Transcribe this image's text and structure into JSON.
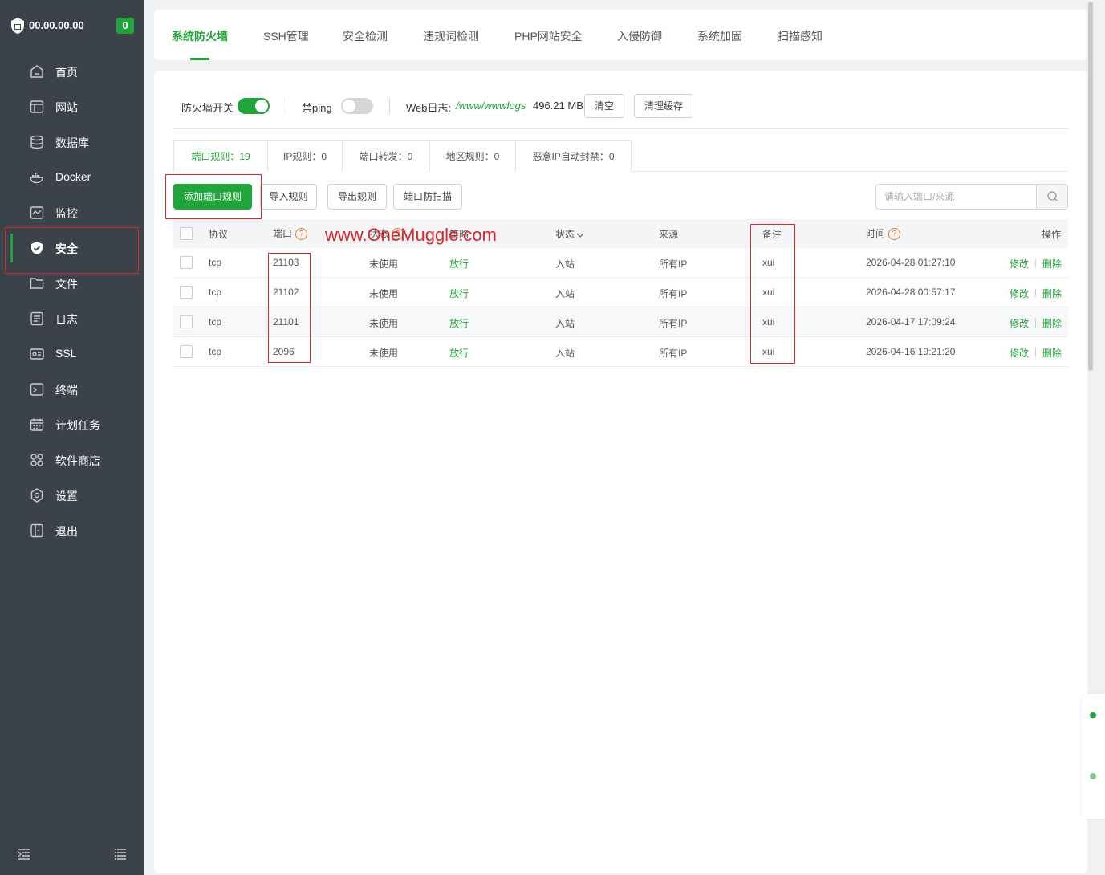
{
  "sidebar": {
    "ip": "00.00.00.00",
    "badge": "0",
    "items": [
      {
        "label": "首页",
        "icon": "home-icon"
      },
      {
        "label": "网站",
        "icon": "website-icon"
      },
      {
        "label": "数据库",
        "icon": "database-icon"
      },
      {
        "label": "Docker",
        "icon": "docker-icon"
      },
      {
        "label": "监控",
        "icon": "monitor-icon"
      },
      {
        "label": "安全",
        "icon": "shield-icon",
        "active": true
      },
      {
        "label": "文件",
        "icon": "folder-icon"
      },
      {
        "label": "日志",
        "icon": "log-icon"
      },
      {
        "label": "SSL",
        "icon": "ssl-icon"
      },
      {
        "label": "终端",
        "icon": "terminal-icon"
      },
      {
        "label": "计划任务",
        "icon": "calendar-icon"
      },
      {
        "label": "软件商店",
        "icon": "app-store-icon"
      },
      {
        "label": "设置",
        "icon": "settings-icon"
      },
      {
        "label": "退出",
        "icon": "logout-icon"
      }
    ]
  },
  "tabs": [
    "系统防火墙",
    "SSH管理",
    "安全检测",
    "违规词检测",
    "PHP网站安全",
    "入侵防御",
    "系统加固",
    "扫描感知"
  ],
  "toolbar": {
    "firewall_label": "防火墙开关",
    "firewall_on": true,
    "ping_label": "禁ping",
    "ping_on": false,
    "weblog_label": "Web日志:",
    "weblog_path": "/www/wwwlogs",
    "weblog_size": "496.21 MB",
    "clear_label": "清空",
    "clear_cache_label": "清理缓存"
  },
  "subtabs": [
    "端口规则：19",
    "IP规则：0",
    "端口转发：0",
    "地区规则：0",
    "恶意IP自动封禁：0"
  ],
  "actions": {
    "add_port_rule": "添加端口规则",
    "import_rules": "导入规则",
    "export_rules": "导出规则",
    "port_anti_scan": "端口防扫描"
  },
  "search": {
    "placeholder": "请输入端口/来源"
  },
  "table": {
    "headers": {
      "protocol": "协议",
      "port": "端口",
      "status": "状态",
      "strategy": "策略",
      "direction": "状态",
      "source": "来源",
      "remark": "备注",
      "time": "时间",
      "ops": "操作"
    },
    "rows": [
      {
        "protocol": "tcp",
        "port": "21103",
        "status": "未使用",
        "strategy": "放行",
        "direction": "入站",
        "source": "所有IP",
        "remark": "xui",
        "time": "2026-04-28 01:27:10",
        "edit": "修改",
        "delete": "删除"
      },
      {
        "protocol": "tcp",
        "port": "21102",
        "status": "未使用",
        "strategy": "放行",
        "direction": "入站",
        "source": "所有IP",
        "remark": "xui",
        "time": "2026-04-28 00:57:17",
        "edit": "修改",
        "delete": "删除"
      },
      {
        "protocol": "tcp",
        "port": "21101",
        "status": "未使用",
        "strategy": "放行",
        "direction": "入站",
        "source": "所有IP",
        "remark": "xui",
        "time": "2026-04-17 17:09:24",
        "edit": "修改",
        "delete": "删除"
      },
      {
        "protocol": "tcp",
        "port": "2096",
        "status": "未使用",
        "strategy": "放行",
        "direction": "入站",
        "source": "所有IP",
        "remark": "xui",
        "time": "2026-04-16 19:21:20",
        "edit": "修改",
        "delete": "删除"
      }
    ]
  },
  "watermark": "www.OneMuggle.com",
  "colors": {
    "accent": "#20a53a",
    "sidebar_bg": "#3b4249",
    "annotation": "#d9262c"
  }
}
